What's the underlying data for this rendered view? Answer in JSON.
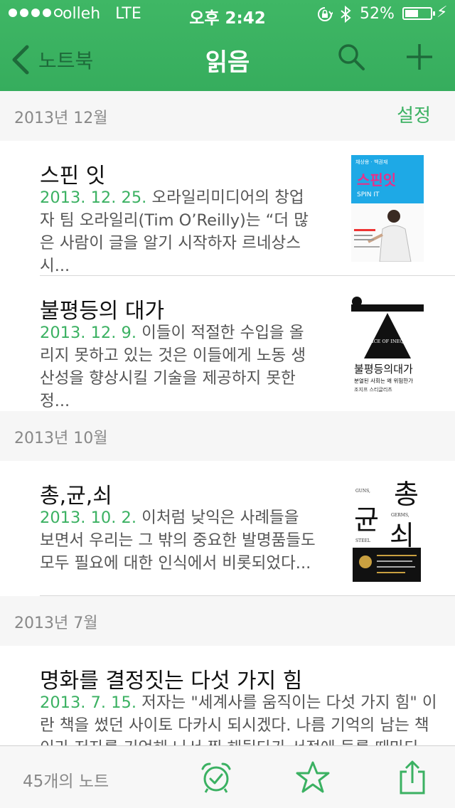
{
  "status_bar": {
    "carrier": "olleh",
    "network": "LTE",
    "time": "오후 2:42",
    "battery_percent": "52%",
    "battery_level": 0.52,
    "icons": [
      "signal-dots",
      "lock-rotation-icon",
      "bluetooth-icon",
      "battery-icon",
      "charging-bolt-icon"
    ]
  },
  "navbar": {
    "back_label": "노트북",
    "title": "읽음",
    "actions": [
      "search-icon",
      "plus-icon"
    ]
  },
  "sections": [
    {
      "title": "2013년 12월",
      "action_label": "설정",
      "notes": [
        {
          "title": "스핀 잇",
          "date": "2013. 12. 25.",
          "snippet": "오라일리미디어의 창업자 팀 오라일리(Tim O’Reilly)는 “더 많은 사람이 글을 알기 시작하자 르네상스시..."
        },
        {
          "title": "불평등의 대가",
          "date": "2013. 12. 9.",
          "snippet": "이들이 적절한 수입을 올리지 못하고 있는 것은 이들에게 노동 생산성을 향상시킬 기술을 제공하지 못한 정..."
        }
      ]
    },
    {
      "title": "2013년 10월",
      "notes": [
        {
          "title": "총,균,쇠",
          "date": "2013. 10. 2.",
          "snippet": "이처럼 낮익은 사례들을 보면서 우리는 그 밖의 중요한 발명품들도 모두 필요에 대한 인식에서 비롯되었다..."
        }
      ]
    },
    {
      "title": "2013년 7월",
      "notes": [
        {
          "title": "명화를 결정짓는 다섯 가지 힘",
          "date": "2013. 7. 15.",
          "snippet": "저자는 \"세계사를 움직이는 다섯 가지 힘\" 이란 책을 썼던 사이토 다카시 되시겠다. 나름 기억의 남는 책이라 저자를 기억해 나서 찜 해뒀다가 서점에 들를 때마다"
        }
      ]
    }
  ],
  "thumbnails": {
    "spin_it": {
      "authors": "채상용 · 백권재",
      "title_ko": "스핀잇",
      "title_en": "SPIN IT"
    },
    "price_of_inequality": {
      "title_en": "THE PRICE OF INEQUALITY",
      "title_ko": "불평등의대가",
      "subtitle": "분열된 사회는 왜 위험한가",
      "author": "조지프 스티글리츠"
    },
    "guns_germs_steel": {
      "chars": [
        "총",
        "균",
        "쇠"
      ],
      "en": [
        "GUNS,",
        "GERMS,",
        "STEEL"
      ]
    }
  },
  "toolbar": {
    "note_count": "45개의 노트",
    "actions": [
      "alarm-icon",
      "star-icon",
      "share-icon"
    ]
  },
  "colors": {
    "brand_green": "#3bb162",
    "header_green": "#3fb765",
    "section_background": "#f6f6f6"
  }
}
